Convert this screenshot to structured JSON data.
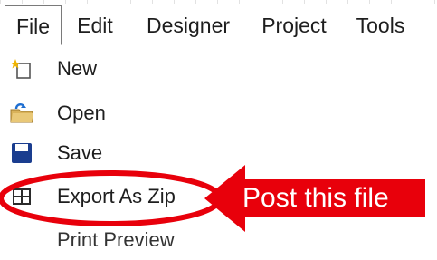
{
  "menubar": {
    "items": [
      {
        "label": "File",
        "active": true
      },
      {
        "label": "Edit",
        "active": false
      },
      {
        "label": "Designer",
        "active": false
      },
      {
        "label": "Project",
        "active": false
      },
      {
        "label": "Tools",
        "active": false
      }
    ]
  },
  "file_menu": {
    "items": [
      {
        "label": "New",
        "icon": "new-document-icon"
      },
      {
        "label": "Open",
        "icon": "open-folder-icon"
      },
      {
        "label": "Save",
        "icon": "save-disk-icon"
      },
      {
        "label": "Export As Zip",
        "icon": "grid-export-icon"
      },
      {
        "label": "Print Preview",
        "icon": ""
      }
    ]
  },
  "annotation": {
    "text": "Post this file",
    "color": "#e8000b"
  }
}
